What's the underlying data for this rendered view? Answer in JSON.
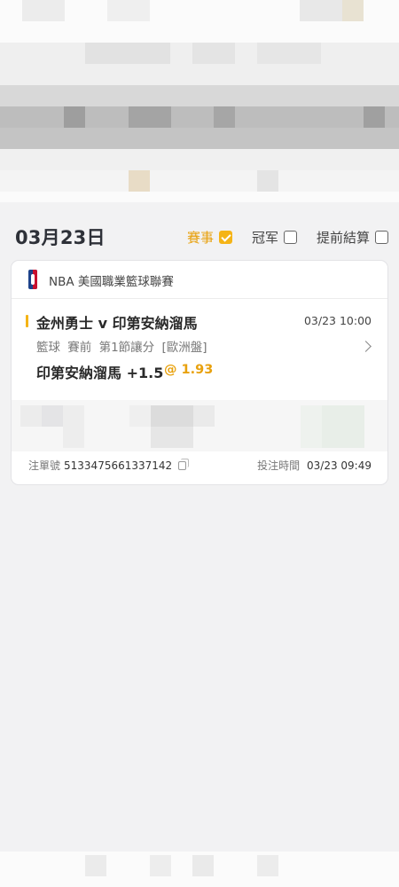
{
  "date": {
    "title": "03月23日"
  },
  "filters": [
    {
      "label": "賽事",
      "checked": true
    },
    {
      "label": "冠军",
      "checked": false
    },
    {
      "label": "提前結算",
      "checked": false
    }
  ],
  "bet": {
    "league": "NBA 美國職業籃球聯賽",
    "match": "金州勇士 v 印第安納溜馬",
    "match_time": "03/23 10:00",
    "detail": "籃球 賽前 第1節讓分 [歐洲盤]",
    "pick": "印第安納溜馬 +1.5",
    "odds": "@ 1.93",
    "ticket_label": "注單號",
    "ticket_number": "5133475661337142",
    "bet_time_label": "投注時間",
    "bet_time": "03/23 09:49"
  },
  "colors": {
    "accent": "#f5b416",
    "accent_text": "#e8a10e",
    "nba_blue": "#1d428a",
    "nba_red": "#c8102e"
  },
  "icons": [
    "nba-logo",
    "checkbox",
    "chevron-right-icon",
    "copy-icon"
  ]
}
